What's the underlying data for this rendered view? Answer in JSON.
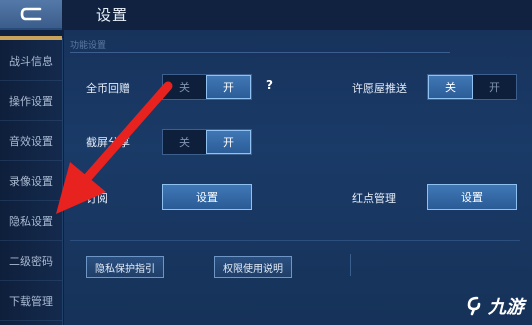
{
  "header": {
    "back_icon": "back-arrow-icon",
    "title": "设置"
  },
  "sidebar": {
    "items": [
      {
        "label": "战斗信息"
      },
      {
        "label": "操作设置"
      },
      {
        "label": "音效设置"
      },
      {
        "label": "录像设置"
      },
      {
        "label": "隐私设置"
      },
      {
        "label": "二级密码"
      },
      {
        "label": "下载管理"
      }
    ]
  },
  "main": {
    "section_header": "功能设置",
    "rows": {
      "gold_replay": {
        "label": "全币回赠",
        "off": "关",
        "on": "开",
        "selected": "on",
        "help": "?"
      },
      "wish_push": {
        "label": "许愿屋推送",
        "off": "关",
        "on": "开",
        "selected": "off"
      },
      "screenshot_share": {
        "label": "截屏分享",
        "off": "关",
        "on": "开",
        "selected": "on"
      },
      "subscribe": {
        "label": "订阅",
        "button": "设置"
      },
      "red_dot": {
        "label": "红点管理",
        "button": "设置"
      }
    },
    "bottom_buttons": {
      "privacy_guide": "隐私保护指引",
      "permission_info": "权限使用说明"
    }
  },
  "overlay": {
    "arrow_color": "#e8231f"
  },
  "watermark": {
    "text": "九游"
  },
  "colors": {
    "accent": "#3f77b4",
    "bg": "#0f2140",
    "highlight_border": "#8fc2f2"
  }
}
